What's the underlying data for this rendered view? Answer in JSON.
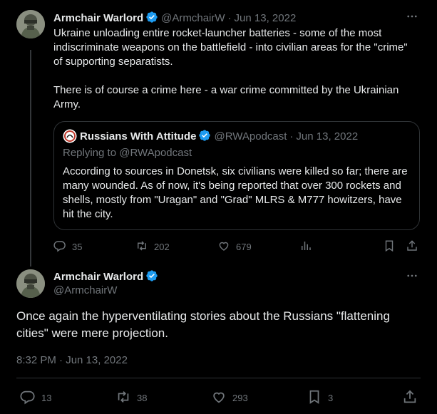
{
  "tweet1": {
    "author_name": "Armchair Warlord",
    "handle": "@ArmchairW",
    "separator": "·",
    "date": "Jun 13, 2022",
    "text": "Ukraine unloading entire rocket-launcher batteries - some of the most indiscriminate weapons on the battlefield - into civilian areas for the \"crime\" of supporting separatists.\n\nThere is of course a crime here - a war crime committed by the Ukrainian Army.",
    "quote": {
      "author_name": "Russians With Attitude",
      "handle": "@RWApodcast",
      "date": "Jun 13, 2022",
      "replying_to": "Replying to @RWApodcast",
      "text": "According to sources in Donetsk, six civilians were killed so far; there are many wounded. As of now, it's being reported that over 300 rockets and shells, mostly from \"Uragan\" and \"Grad\" MLRS & M777 howitzers, have hit the city."
    },
    "actions": {
      "replies": "35",
      "retweets": "202",
      "likes": "679"
    }
  },
  "tweet2": {
    "author_name": "Armchair Warlord",
    "handle": "@ArmchairW",
    "text": "Once again the hyperventilating stories about the Russians \"flattening cities\" were mere projection.",
    "timestamp": "8:32 PM · Jun 13, 2022",
    "actions": {
      "replies": "13",
      "retweets": "38",
      "likes": "293",
      "bookmarks": "3"
    }
  },
  "colors": {
    "background": "#000000",
    "text": "#e7e9ea",
    "secondary": "#71767b",
    "verified": "#1d9bf0",
    "border": "#2f3336"
  },
  "icons": [
    "more-icon",
    "verified-icon",
    "reply-icon",
    "retweet-icon",
    "like-icon",
    "views-icon",
    "bookmark-icon",
    "share-icon"
  ]
}
